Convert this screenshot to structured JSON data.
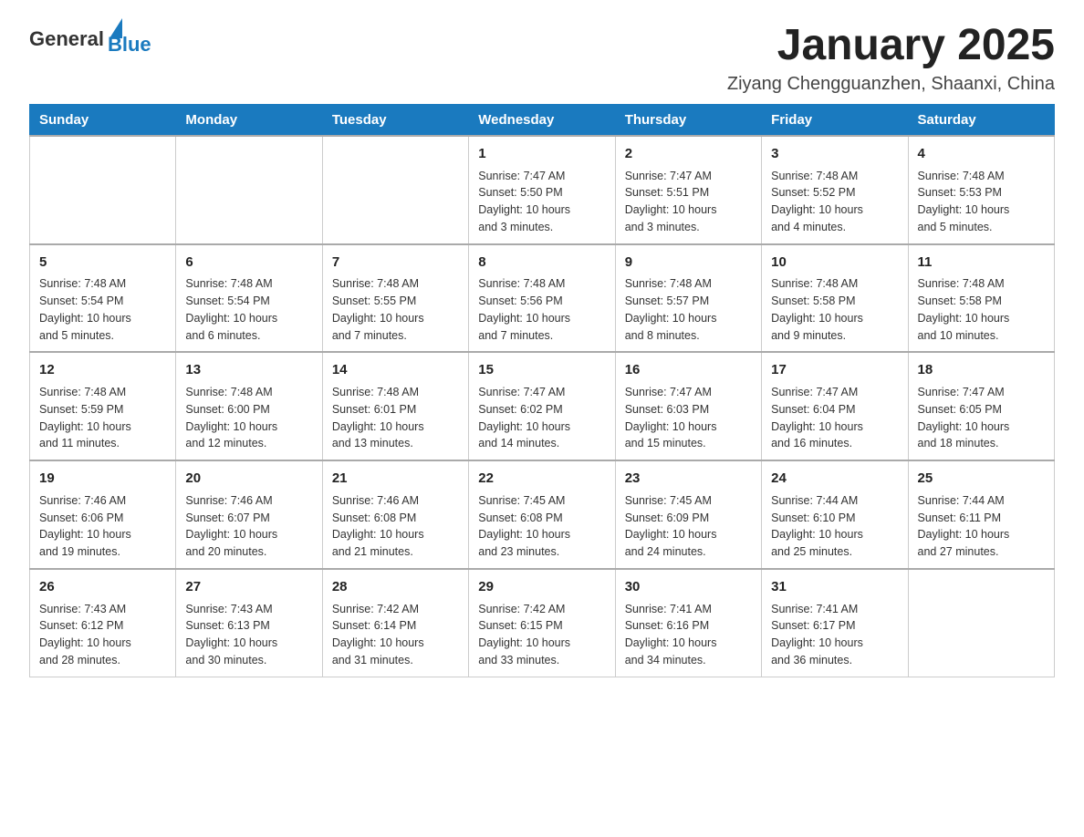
{
  "logo": {
    "text_general": "General",
    "text_blue": "Blue"
  },
  "title": "January 2025",
  "subtitle": "Ziyang Chengguanzhen, Shaanxi, China",
  "days_of_week": [
    "Sunday",
    "Monday",
    "Tuesday",
    "Wednesday",
    "Thursday",
    "Friday",
    "Saturday"
  ],
  "weeks": [
    [
      {
        "day": "",
        "info": ""
      },
      {
        "day": "",
        "info": ""
      },
      {
        "day": "",
        "info": ""
      },
      {
        "day": "1",
        "info": "Sunrise: 7:47 AM\nSunset: 5:50 PM\nDaylight: 10 hours\nand 3 minutes."
      },
      {
        "day": "2",
        "info": "Sunrise: 7:47 AM\nSunset: 5:51 PM\nDaylight: 10 hours\nand 3 minutes."
      },
      {
        "day": "3",
        "info": "Sunrise: 7:48 AM\nSunset: 5:52 PM\nDaylight: 10 hours\nand 4 minutes."
      },
      {
        "day": "4",
        "info": "Sunrise: 7:48 AM\nSunset: 5:53 PM\nDaylight: 10 hours\nand 5 minutes."
      }
    ],
    [
      {
        "day": "5",
        "info": "Sunrise: 7:48 AM\nSunset: 5:54 PM\nDaylight: 10 hours\nand 5 minutes."
      },
      {
        "day": "6",
        "info": "Sunrise: 7:48 AM\nSunset: 5:54 PM\nDaylight: 10 hours\nand 6 minutes."
      },
      {
        "day": "7",
        "info": "Sunrise: 7:48 AM\nSunset: 5:55 PM\nDaylight: 10 hours\nand 7 minutes."
      },
      {
        "day": "8",
        "info": "Sunrise: 7:48 AM\nSunset: 5:56 PM\nDaylight: 10 hours\nand 7 minutes."
      },
      {
        "day": "9",
        "info": "Sunrise: 7:48 AM\nSunset: 5:57 PM\nDaylight: 10 hours\nand 8 minutes."
      },
      {
        "day": "10",
        "info": "Sunrise: 7:48 AM\nSunset: 5:58 PM\nDaylight: 10 hours\nand 9 minutes."
      },
      {
        "day": "11",
        "info": "Sunrise: 7:48 AM\nSunset: 5:58 PM\nDaylight: 10 hours\nand 10 minutes."
      }
    ],
    [
      {
        "day": "12",
        "info": "Sunrise: 7:48 AM\nSunset: 5:59 PM\nDaylight: 10 hours\nand 11 minutes."
      },
      {
        "day": "13",
        "info": "Sunrise: 7:48 AM\nSunset: 6:00 PM\nDaylight: 10 hours\nand 12 minutes."
      },
      {
        "day": "14",
        "info": "Sunrise: 7:48 AM\nSunset: 6:01 PM\nDaylight: 10 hours\nand 13 minutes."
      },
      {
        "day": "15",
        "info": "Sunrise: 7:47 AM\nSunset: 6:02 PM\nDaylight: 10 hours\nand 14 minutes."
      },
      {
        "day": "16",
        "info": "Sunrise: 7:47 AM\nSunset: 6:03 PM\nDaylight: 10 hours\nand 15 minutes."
      },
      {
        "day": "17",
        "info": "Sunrise: 7:47 AM\nSunset: 6:04 PM\nDaylight: 10 hours\nand 16 minutes."
      },
      {
        "day": "18",
        "info": "Sunrise: 7:47 AM\nSunset: 6:05 PM\nDaylight: 10 hours\nand 18 minutes."
      }
    ],
    [
      {
        "day": "19",
        "info": "Sunrise: 7:46 AM\nSunset: 6:06 PM\nDaylight: 10 hours\nand 19 minutes."
      },
      {
        "day": "20",
        "info": "Sunrise: 7:46 AM\nSunset: 6:07 PM\nDaylight: 10 hours\nand 20 minutes."
      },
      {
        "day": "21",
        "info": "Sunrise: 7:46 AM\nSunset: 6:08 PM\nDaylight: 10 hours\nand 21 minutes."
      },
      {
        "day": "22",
        "info": "Sunrise: 7:45 AM\nSunset: 6:08 PM\nDaylight: 10 hours\nand 23 minutes."
      },
      {
        "day": "23",
        "info": "Sunrise: 7:45 AM\nSunset: 6:09 PM\nDaylight: 10 hours\nand 24 minutes."
      },
      {
        "day": "24",
        "info": "Sunrise: 7:44 AM\nSunset: 6:10 PM\nDaylight: 10 hours\nand 25 minutes."
      },
      {
        "day": "25",
        "info": "Sunrise: 7:44 AM\nSunset: 6:11 PM\nDaylight: 10 hours\nand 27 minutes."
      }
    ],
    [
      {
        "day": "26",
        "info": "Sunrise: 7:43 AM\nSunset: 6:12 PM\nDaylight: 10 hours\nand 28 minutes."
      },
      {
        "day": "27",
        "info": "Sunrise: 7:43 AM\nSunset: 6:13 PM\nDaylight: 10 hours\nand 30 minutes."
      },
      {
        "day": "28",
        "info": "Sunrise: 7:42 AM\nSunset: 6:14 PM\nDaylight: 10 hours\nand 31 minutes."
      },
      {
        "day": "29",
        "info": "Sunrise: 7:42 AM\nSunset: 6:15 PM\nDaylight: 10 hours\nand 33 minutes."
      },
      {
        "day": "30",
        "info": "Sunrise: 7:41 AM\nSunset: 6:16 PM\nDaylight: 10 hours\nand 34 minutes."
      },
      {
        "day": "31",
        "info": "Sunrise: 7:41 AM\nSunset: 6:17 PM\nDaylight: 10 hours\nand 36 minutes."
      },
      {
        "day": "",
        "info": ""
      }
    ]
  ]
}
